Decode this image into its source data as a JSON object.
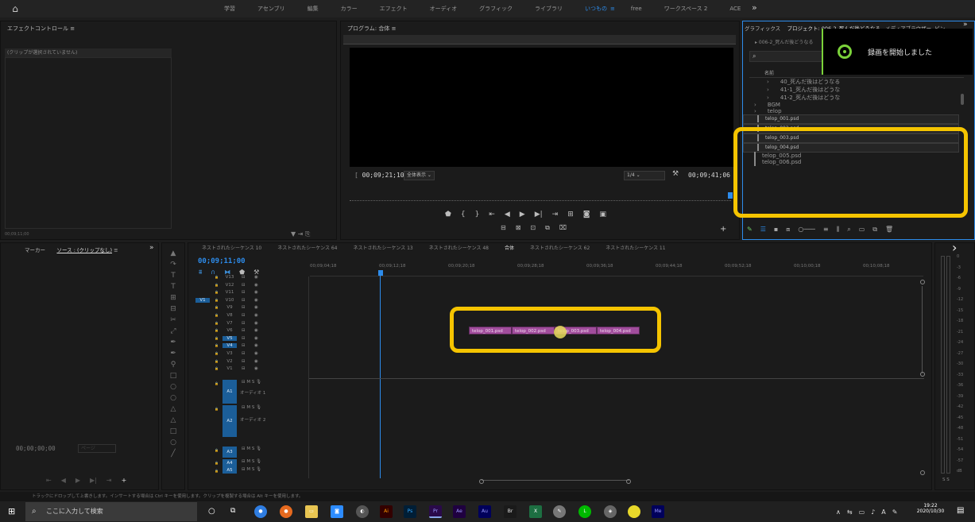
{
  "workspaces": [
    "学習",
    "アセンブリ",
    "編集",
    "カラー",
    "エフェクト",
    "オーディオ",
    "グラフィック",
    "ライブラリ",
    "いつもの",
    "free",
    "ワークスペース 2",
    "ACE"
  ],
  "active_workspace_index": 8,
  "effects": {
    "title": "エフェクトコントロール",
    "clip_status": "(クリップが選択されていません)",
    "timecode": "00;09;11;00"
  },
  "program": {
    "title": "プログラム: 合体",
    "timecode_left": "00;09;21;10",
    "fit": "全体表示",
    "quality": "1/4",
    "timecode_right": "00;09;41;06"
  },
  "project": {
    "tabs": [
      "グラフィックス",
      "プロジェクト: 006-2_死んだ後どうなる",
      "メディアブラウザー",
      "ビン"
    ],
    "bin_path": "006-2_死んだ後どうなる",
    "column_name": "名前",
    "items": [
      {
        "name": "40_死んだ後はどうなる",
        "color": "#e8a33d",
        "kind": "folder"
      },
      {
        "name": "41-1_死んだ後はどうな",
        "color": "#e8a33d",
        "kind": "folder"
      },
      {
        "name": "41-2_死んだ後はどうな",
        "color": "#e8a33d",
        "kind": "folder"
      },
      {
        "name": "BGM",
        "color": "#e8a33d",
        "kind": "folder"
      },
      {
        "name": "telop",
        "color": "#e8a33d",
        "kind": "folder"
      },
      {
        "name": "telop_001.psd",
        "color": "#e48ee0",
        "kind": "psd",
        "selected": true
      },
      {
        "name": "telop_002.psd",
        "color": "#e48ee0",
        "kind": "psd",
        "selected": true
      },
      {
        "name": "telop_003.psd",
        "color": "#e48ee0",
        "kind": "psd",
        "selected": true
      },
      {
        "name": "telop_004.psd",
        "color": "#e48ee0",
        "kind": "psd",
        "selected": true
      },
      {
        "name": "telop_005.psd",
        "color": "#e48ee0",
        "kind": "psd",
        "selected": false
      },
      {
        "name": "telop_006.psd",
        "color": "#e48ee0",
        "kind": "psd",
        "selected": false
      }
    ]
  },
  "notification": {
    "message": "録画を開始しました"
  },
  "source": {
    "tabs": [
      "マーカー",
      "ソース : (クリップなし)"
    ],
    "timecode": "00;00;00;00",
    "page": "ページ"
  },
  "timeline": {
    "tabs": [
      "ネストされたシーケンス 10",
      "ネストされたシーケンス 64",
      "ネストされたシーケンス 13",
      "ネストされたシーケンス 48",
      "合体",
      "ネストされたシーケンス 62",
      "ネストされたシーケンス 11"
    ],
    "active_tab_index": 4,
    "timecode": "00;09;11;00",
    "ruler": [
      "00;09;04;18",
      "00;09;12;18",
      "00;09;20;18",
      "00;09;28;18",
      "00;09;36;18",
      "00;09;44;18",
      "00;09;52;18",
      "00;10;00;18",
      "00;10;08;18"
    ],
    "video_tracks": [
      "V13",
      "V12",
      "V11",
      "V10",
      "V9",
      "V8",
      "V7",
      "V6",
      "V5",
      "V4",
      "V3",
      "V2",
      "V1"
    ],
    "audio_tracks": [
      "A1",
      "A2",
      "A3",
      "A4",
      "A5"
    ],
    "audio_names": [
      "オーディオ 1",
      "オーディオ 2"
    ],
    "clips": [
      "telop_001.psd",
      "telop_002.psd",
      "telop_003.psd",
      "telop_004.psd"
    ]
  },
  "meters": [
    "0",
    "-3",
    "-6",
    "-9",
    "-12",
    "-15",
    "-18",
    "-21",
    "-24",
    "-27",
    "-30",
    "-33",
    "-36",
    "-39",
    "-42",
    "-45",
    "-48",
    "-51",
    "-54",
    "-57",
    "dB"
  ],
  "status_text": "トラックにドロップして上書きします。インサートする場合は Ctrl キーを使用します。クリップを複製する場合は Alt キーを使用します。",
  "taskbar": {
    "search_placeholder": "ここに入力して検索",
    "time": "19:22",
    "date": "2020/10/30"
  },
  "accent": "#2d8ceb",
  "annotation_color": "#f5c400"
}
